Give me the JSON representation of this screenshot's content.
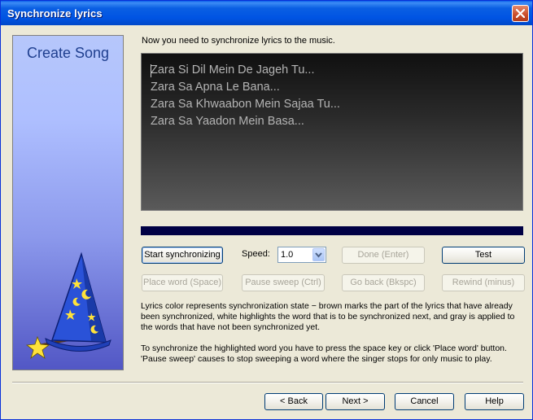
{
  "window": {
    "title": "Synchronize lyrics"
  },
  "sidebar": {
    "title": "Create Song"
  },
  "main": {
    "instruction": "Now you need to synchronize lyrics to the music.",
    "lyrics": [
      "Zara Si Dil Mein De Jageh Tu...",
      "Zara Sa Apna Le Bana...",
      "Zara Sa Khwaabon Mein Sajaa Tu...",
      "Zara Sa Yaadon Mein Basa..."
    ],
    "progress": 0
  },
  "controls": {
    "start_label": "Start synchronizing",
    "speed_label": "Speed:",
    "speed_value": "1.0",
    "done_label": "Done (Enter)",
    "test_label": "Test",
    "place_word_label": "Place word (Space)",
    "pause_sweep_label": "Pause sweep (Ctrl)",
    "go_back_label": "Go back (Bkspc)",
    "rewind_label": "Rewind (minus)"
  },
  "descriptions": {
    "color_info": "Lyrics color represents synchronization state − brown marks the part of the lyrics that have already been synchronized, white highlights the word that is to be synchronized next, and gray is applied to the words that have not been synchronized yet.",
    "sync_info": "To synchronize the highlighted word you have to press the space key or click 'Place word' button. 'Pause sweep' causes to stop sweeping a word where the singer stops for only music to play."
  },
  "footer": {
    "back_label": "Back",
    "next_label": "Next >",
    "cancel_label": "Cancel",
    "help_label": "Help"
  }
}
